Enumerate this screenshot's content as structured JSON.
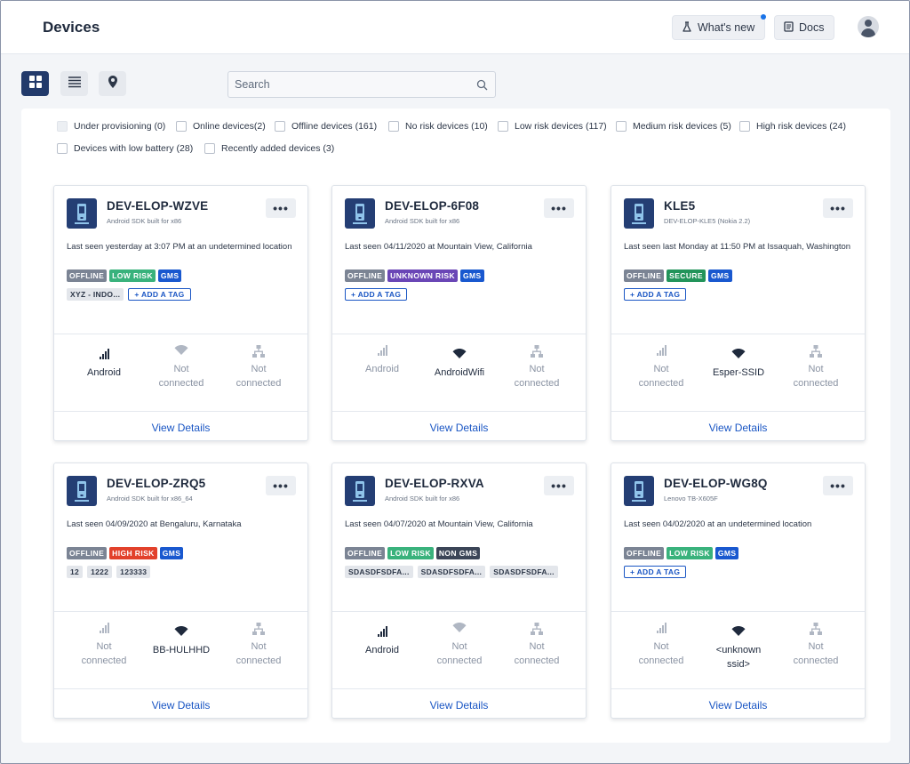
{
  "header": {
    "title": "Devices",
    "whats_new": "What's new",
    "docs": "Docs",
    "flask_icon": "flask-icon",
    "doc_icon": "document-icon"
  },
  "search": {
    "placeholder": "Search"
  },
  "filters": [
    "Under provisioning (0)",
    "Online devices(2)",
    "Offline devices (161)",
    "No risk devices (10)",
    "Low risk devices (117)",
    "Medium risk devices (5)",
    "High risk devices (24)",
    "Devices with low battery (28)",
    "Recently added devices (3)"
  ],
  "colors": {
    "accent": "#1a56c4",
    "offline": "#7b8494",
    "low_risk": "#39b27c",
    "high_risk": "#e2412b",
    "unknown_risk": "#6a46b6",
    "secure": "#22945a",
    "gms": "#1958cf",
    "non_gms": "#3b4557"
  },
  "common": {
    "view_details": "View Details",
    "add_tag": "+ ADD A TAG",
    "more": "•••"
  },
  "cards": [
    {
      "name": "DEV-ELOP-WZVE",
      "sub": "Android SDK built for x86",
      "last_seen": "Last seen yesterday at 3:07 PM at an undetermined location",
      "tags": [
        "OFFLINE",
        "LOW RISK",
        "GMS"
      ],
      "user_tags": [
        "XYZ - INDO..."
      ],
      "add_tag": true,
      "conn": [
        {
          "text": "Android",
          "active": true
        },
        {
          "text": "Not connected",
          "active": false
        },
        {
          "text": "Not connected",
          "active": false
        }
      ]
    },
    {
      "name": "DEV-ELOP-6F08",
      "sub": "Android SDK built for x86",
      "last_seen": "Last seen 04/11/2020 at Mountain View, California",
      "tags": [
        "OFFLINE",
        "UNKNOWN RISK",
        "GMS"
      ],
      "user_tags": [],
      "add_tag": true,
      "conn": [
        {
          "text": "Android",
          "active": false
        },
        {
          "text": "AndroidWifi",
          "active": true
        },
        {
          "text": "Not connected",
          "active": false
        }
      ]
    },
    {
      "name": "KLE5",
      "sub": "DEV-ELOP-KLE5 (Nokia 2.2)",
      "last_seen": "Last seen last Monday at 11:50 PM at Issaquah, Washington",
      "tags": [
        "OFFLINE",
        "SECURE",
        "GMS"
      ],
      "user_tags": [],
      "add_tag": true,
      "conn": [
        {
          "text": "Not connected",
          "active": false
        },
        {
          "text": "Esper-SSID",
          "active": true
        },
        {
          "text": "Not connected",
          "active": false
        }
      ]
    },
    {
      "name": "DEV-ELOP-ZRQ5",
      "sub": "Android SDK built for x86_64",
      "last_seen": "Last seen 04/09/2020 at Bengaluru, Karnataka",
      "tags": [
        "OFFLINE",
        "HIGH RISK",
        "GMS"
      ],
      "user_tags": [
        "12",
        "1222",
        "123333"
      ],
      "add_tag": false,
      "conn": [
        {
          "text": "Not connected",
          "active": false
        },
        {
          "text": "BB-HULHHD",
          "active": true
        },
        {
          "text": "Not connected",
          "active": false
        }
      ]
    },
    {
      "name": "DEV-ELOP-RXVA",
      "sub": "Android SDK built for x86",
      "last_seen": "Last seen 04/07/2020 at Mountain View, California",
      "tags": [
        "OFFLINE",
        "LOW RISK",
        "NON GMS"
      ],
      "user_tags": [
        "SDASDFSDFA...",
        "SDASDFSDFA...",
        "SDASDFSDFA..."
      ],
      "add_tag": false,
      "conn": [
        {
          "text": "Android",
          "active": true
        },
        {
          "text": "Not connected",
          "active": false
        },
        {
          "text": "Not connected",
          "active": false
        }
      ]
    },
    {
      "name": "DEV-ELOP-WG8Q",
      "sub": "Lenovo TB-X605F",
      "last_seen": "Last seen 04/02/2020 at an undetermined location",
      "tags": [
        "OFFLINE",
        "LOW RISK",
        "GMS"
      ],
      "user_tags": [],
      "add_tag": true,
      "conn": [
        {
          "text": "Not connected",
          "active": false
        },
        {
          "text": "<unknown ssid>",
          "active": true
        },
        {
          "text": "Not connected",
          "active": false
        }
      ]
    }
  ]
}
